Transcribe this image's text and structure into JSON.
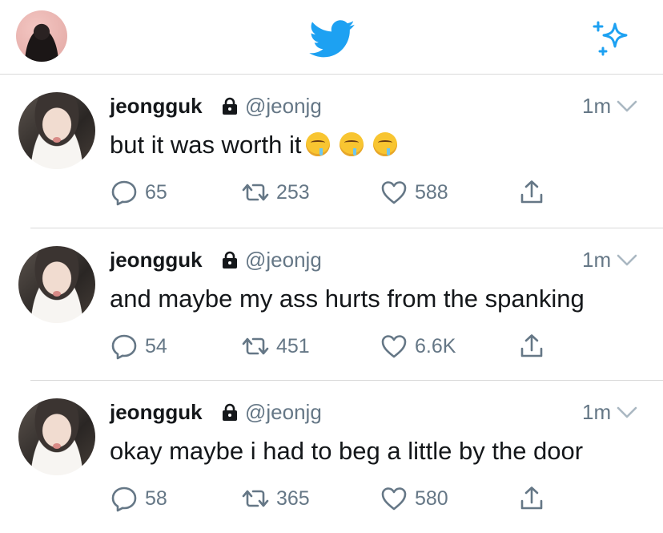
{
  "header": {
    "avatar_icon": "profile-avatar",
    "logo_icon": "twitter-bird-icon",
    "sparkle_icon": "sparkle-icon",
    "brand_color": "#1da1f2"
  },
  "tweets": [
    {
      "name": "jeongguk",
      "handle": "@jeonjg",
      "time": "1m",
      "text": "but it was worth it",
      "emoji": [
        "drooling-face",
        "drooling-face",
        "drooling-face"
      ],
      "replies": "65",
      "retweets": "253",
      "likes": "588"
    },
    {
      "name": "jeongguk",
      "handle": "@jeonjg",
      "time": "1m",
      "text": "and maybe my ass hurts from the spanking",
      "emoji": [],
      "replies": "54",
      "retweets": "451",
      "likes": "6.6K"
    },
    {
      "name": "jeongguk",
      "handle": "@jeonjg",
      "time": "1m",
      "text": "okay maybe i had to beg a little by the door",
      "emoji": [],
      "replies": "58",
      "retweets": "365",
      "likes": "580"
    }
  ]
}
